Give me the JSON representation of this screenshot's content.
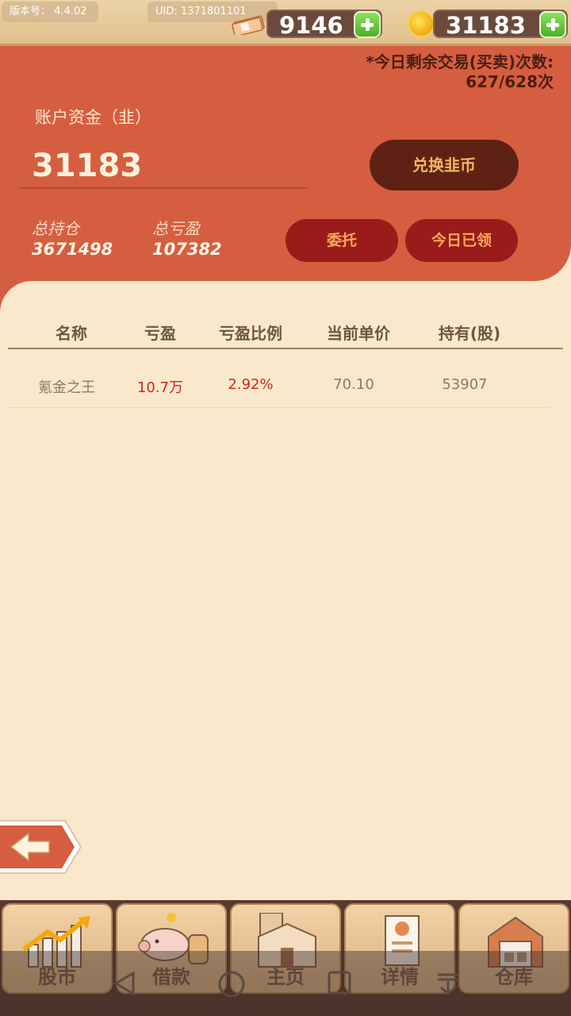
{
  "topbar": {
    "version_text": "版本号：  4.4.02",
    "uid_text": "UID: 1371801101",
    "cash_value": "9146",
    "coin_value": "31183"
  },
  "header": {
    "trades_line1": "*今日剩余交易(买卖)次数:",
    "trades_line2": "627/628次",
    "account_label": "账户资金（韭）",
    "account_value": "31183",
    "exchange_button": "兑换韭币",
    "total_position_label": "总持仓",
    "total_position_value": "3671498",
    "total_pnl_label": "总亏盈",
    "total_pnl_value": "107382",
    "entrust_button": "委托",
    "claimed_button": "今日已领"
  },
  "table": {
    "headers": [
      "名称",
      "亏盈",
      "亏盈比例",
      "当前单价",
      "持有(股)"
    ],
    "rows": [
      {
        "name": "氪金之王",
        "pnl": "10.7万",
        "pnl_ratio": "2.92%",
        "price": "70.10",
        "held": "53907"
      }
    ]
  },
  "nav": {
    "items": [
      {
        "label": "股市",
        "icon": "stock-chart-icon"
      },
      {
        "label": "借款",
        "icon": "piggy-bank-icon"
      },
      {
        "label": "主页",
        "icon": "home-building-icon"
      },
      {
        "label": "详情",
        "icon": "profile-card-icon"
      },
      {
        "label": "仓库",
        "icon": "warehouse-icon"
      }
    ]
  },
  "colors": {
    "panel_red": "#d65e40",
    "background_cream": "#f9e8cb",
    "loss_gain_red": "#d6241c",
    "button_brown": "#5e2215",
    "button_dark_red": "#9a1b1a"
  }
}
